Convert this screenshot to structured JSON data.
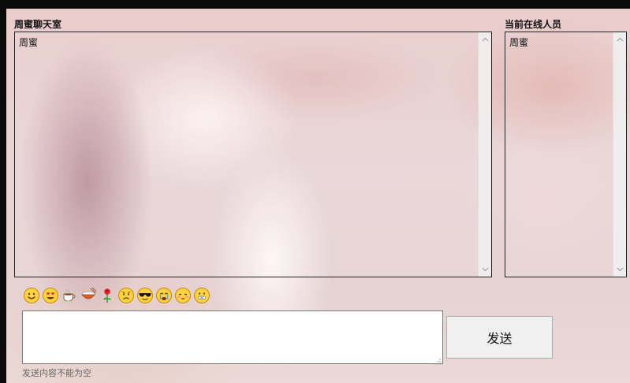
{
  "chat": {
    "title": "周蜜聊天室",
    "messages": [
      "周蜜"
    ]
  },
  "online": {
    "title": "当前在线人员",
    "users": [
      "周蜜"
    ]
  },
  "emojis": [
    {
      "name": "smile-emoji-icon"
    },
    {
      "name": "heart-eyes-emoji-icon"
    },
    {
      "name": "coffee-cup-icon"
    },
    {
      "name": "rice-bowl-icon"
    },
    {
      "name": "rose-icon"
    },
    {
      "name": "sad-emoji-icon"
    },
    {
      "name": "cool-sunglasses-emoji-icon"
    },
    {
      "name": "crying-emoji-icon"
    },
    {
      "name": "shy-emoji-icon"
    },
    {
      "name": "sealed-lips-emoji-icon"
    }
  ],
  "composer": {
    "value": "",
    "send_label": "发送",
    "hint": "发送内容不能为空"
  },
  "colors": {
    "frame": "#0b0b0b",
    "panel_border": "#222222",
    "button_bg": "#f0f0f0"
  }
}
